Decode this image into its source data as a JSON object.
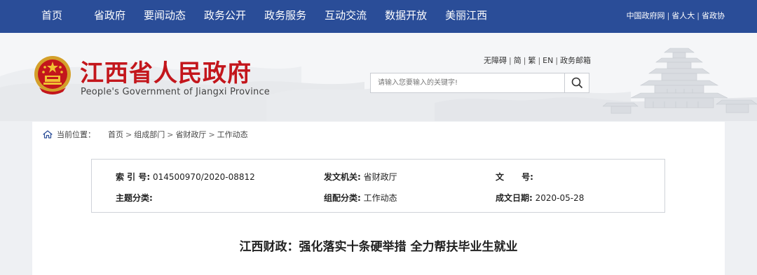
{
  "nav": {
    "items": [
      "首页",
      "省政府",
      "要闻动态",
      "政务公开",
      "政务服务",
      "互动交流",
      "数据开放",
      "美丽江西"
    ],
    "links": [
      "中国政府网",
      "省人大",
      "省政协"
    ]
  },
  "header": {
    "title": "江西省人民政府",
    "subtitle": "People's Government of Jiangxi Province",
    "util_links": [
      "无障碍",
      "简",
      "繁",
      "EN",
      "政务邮箱"
    ],
    "search_placeholder": "请输入您要输入的关键字!"
  },
  "breadcrumb": {
    "label": "当前位置：",
    "items": [
      "首页",
      "组成部门",
      "省财政厅",
      "工作动态"
    ]
  },
  "meta": {
    "index_label": "索 引 号:",
    "index_value": "014500970/2020-08812",
    "issuer_label": "发文机关:",
    "issuer_value": "省财政厅",
    "docno_label": "文      号:",
    "docno_value": "",
    "topic_label": "主题分类:",
    "topic_value": "",
    "category_label": "组配分类:",
    "category_value": "工作动态",
    "date_label": "成文日期:",
    "date_value": "2020-05-28"
  },
  "article": {
    "title": "江西财政：强化落实十条硬举措 全力帮扶毕业生就业"
  },
  "colors": {
    "nav_bg": "#2a4d98",
    "title_red": "#c3161c",
    "page_bg": "#eef0f3"
  }
}
